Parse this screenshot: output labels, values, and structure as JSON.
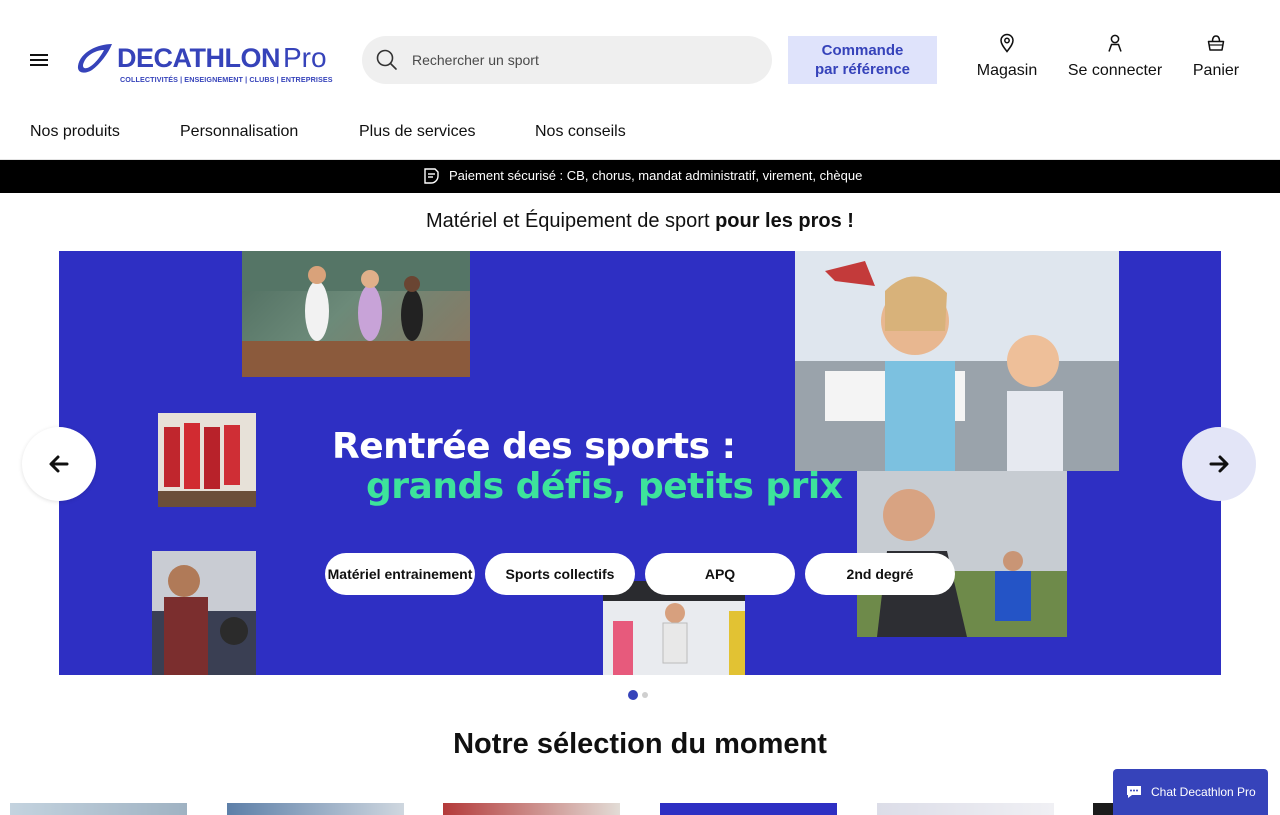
{
  "header": {
    "logo": {
      "word": "DECATHLON",
      "pro": "Pro",
      "tagline": "COLLECTIVITÉS | ENSEIGNEMENT | CLUBS | ENTREPRISES"
    },
    "search": {
      "placeholder": "Rechercher un sport",
      "value": ""
    },
    "order_button": {
      "line1": "Commande",
      "line2": "par référence"
    },
    "actions": {
      "store": "Magasin",
      "login": "Se connecter",
      "cart": "Panier"
    }
  },
  "nav": {
    "items": [
      "Nos produits",
      "Personnalisation",
      "Plus de services",
      "Nos conseils"
    ]
  },
  "infobar": {
    "text": "Paiement sécurisé : CB, chorus, mandat administratif, virement, chèque"
  },
  "tagline": {
    "normal": "Matériel et Équipement de sport ",
    "bold": "pour les pros !"
  },
  "hero": {
    "title_line1": "Rentrée des sports :",
    "title_line2": "grands défis, petits prix",
    "buttons": [
      "Matériel entrainement",
      "Sports collectifs",
      "APQ",
      "2nd degré"
    ],
    "slide_current": 1,
    "slide_total": 2
  },
  "selection": {
    "title": "Notre sélection du moment"
  },
  "chat": {
    "label": "Chat Decathlon Pro"
  },
  "colors": {
    "brand": "#3643ba",
    "hero_bg": "#2e2fc3",
    "hero_accent": "#3de39b",
    "ref_button_bg": "#dfe3fb",
    "infobar_bg": "#000000"
  },
  "icons": {
    "menu": "hamburger-menu-icon",
    "search": "search-icon",
    "store": "location-pin-icon",
    "login": "user-icon",
    "cart": "basket-icon",
    "payment": "secure-payment-icon",
    "prev": "arrow-left-icon",
    "next": "arrow-right-icon",
    "chat": "chat-bubble-icon"
  }
}
